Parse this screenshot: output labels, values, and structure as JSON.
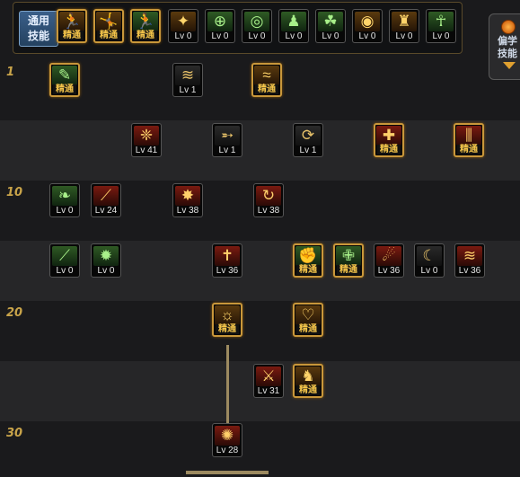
{
  "common_panel": {
    "label": "通用\n技能"
  },
  "right_panel": {
    "label": "偏学\n技能"
  },
  "level_labels": [
    "1",
    "10",
    "20",
    "30"
  ],
  "common_skills": [
    {
      "icon": "running-figure-icon",
      "tint": "gold",
      "text": "精通",
      "mastered": true
    },
    {
      "icon": "leaping-figure-icon",
      "tint": "gold",
      "text": "精通",
      "mastered": true
    },
    {
      "icon": "dash-figure-icon",
      "tint": "green",
      "text": "精通",
      "mastered": true
    },
    {
      "icon": "winged-emblem-icon",
      "tint": "gold",
      "text": "Lv 0",
      "mastered": false
    },
    {
      "icon": "crosshair-icon",
      "tint": "green",
      "text": "Lv 0",
      "mastered": false
    },
    {
      "icon": "target-reticle-icon",
      "tint": "green",
      "text": "Lv 0",
      "mastered": false
    },
    {
      "icon": "figure-pose-icon",
      "tint": "green",
      "text": "Lv 0",
      "mastered": false
    },
    {
      "icon": "figure-swirl-icon",
      "tint": "green",
      "text": "Lv 0",
      "mastered": false
    },
    {
      "icon": "eye-icon",
      "tint": "gold",
      "text": "Lv 0",
      "mastered": false
    },
    {
      "icon": "crowd-icon",
      "tint": "gold",
      "text": "Lv 0",
      "mastered": false
    },
    {
      "icon": "spirit-figure-icon",
      "tint": "green",
      "text": "Lv 0",
      "mastered": false
    }
  ],
  "skills": {
    "r1": [
      {
        "icon": "scroll-icon",
        "tint": "green",
        "text": "精通",
        "mastered": true
      },
      {
        "icon": "claw-slash-icon",
        "tint": "dark",
        "text": "Lv 1",
        "mastered": false
      },
      {
        "icon": "wave-slash-icon",
        "tint": "gold",
        "text": "精通",
        "mastered": true
      }
    ],
    "r2": [
      {
        "icon": "wing-burst-icon",
        "tint": "red",
        "text": "Lv 41",
        "mastered": false
      },
      {
        "icon": "arrow-strike-icon",
        "tint": "dark",
        "text": "Lv 1",
        "mastered": false
      },
      {
        "icon": "whirlwind-icon",
        "tint": "dark",
        "text": "Lv 1",
        "mastered": false
      },
      {
        "icon": "shield-icon",
        "tint": "red",
        "text": "精通",
        "mastered": true
      },
      {
        "icon": "triple-blade-icon",
        "tint": "red",
        "text": "精通",
        "mastered": true
      }
    ],
    "r3": [
      {
        "icon": "leaf-blade-icon",
        "tint": "green",
        "text": "Lv 0",
        "mastered": false
      },
      {
        "icon": "long-blade-icon",
        "tint": "red",
        "text": "Lv 24",
        "mastered": false
      },
      {
        "icon": "explosion-icon",
        "tint": "red",
        "text": "Lv 38",
        "mastered": false
      },
      {
        "icon": "spiral-strike-icon",
        "tint": "red",
        "text": "Lv 38",
        "mastered": false
      }
    ],
    "r4": [
      {
        "icon": "greatsword-icon",
        "tint": "green",
        "text": "Lv 0",
        "mastered": false
      },
      {
        "icon": "green-burst-icon",
        "tint": "green",
        "text": "Lv 0",
        "mastered": false
      },
      {
        "icon": "cross-blade-icon",
        "tint": "red",
        "text": "Lv 36",
        "mastered": false
      },
      {
        "icon": "muscle-figure-icon",
        "tint": "green",
        "text": "精通",
        "mastered": true
      },
      {
        "icon": "holy-cross-icon",
        "tint": "green",
        "text": "精通",
        "mastered": true
      },
      {
        "icon": "fire-arc-icon",
        "tint": "red",
        "text": "Lv 36",
        "mastered": false
      },
      {
        "icon": "crescent-icon",
        "tint": "dark",
        "text": "Lv 0",
        "mastered": false
      },
      {
        "icon": "flame-wave-icon",
        "tint": "red",
        "text": "Lv 36",
        "mastered": false
      }
    ],
    "r5": [
      {
        "icon": "radiant-orb-icon",
        "tint": "gold",
        "text": "精通",
        "mastered": true
      },
      {
        "icon": "heart-guard-icon",
        "tint": "gold",
        "text": "精通",
        "mastered": true
      }
    ],
    "r6": [
      {
        "icon": "fury-slash-icon",
        "tint": "red",
        "text": "Lv 31",
        "mastered": false
      },
      {
        "icon": "rising-figure-icon",
        "tint": "gold",
        "text": "精通",
        "mastered": true
      }
    ],
    "r7": [
      {
        "icon": "starburst-icon",
        "tint": "red",
        "text": "Lv 28",
        "mastered": false
      }
    ]
  },
  "glyphs": {
    "running-figure-icon": "🏃",
    "leaping-figure-icon": "🤸",
    "dash-figure-icon": "🏃",
    "winged-emblem-icon": "✦",
    "crosshair-icon": "⊕",
    "target-reticle-icon": "◎",
    "figure-pose-icon": "♟",
    "figure-swirl-icon": "☘",
    "eye-icon": "◉",
    "crowd-icon": "♜",
    "spirit-figure-icon": "☥",
    "scroll-icon": "✎",
    "claw-slash-icon": "≋",
    "wave-slash-icon": "≈",
    "wing-burst-icon": "❈",
    "arrow-strike-icon": "➵",
    "whirlwind-icon": "⟳",
    "shield-icon": "✚",
    "triple-blade-icon": "⫼",
    "leaf-blade-icon": "❧",
    "long-blade-icon": "⟋",
    "explosion-icon": "✸",
    "spiral-strike-icon": "↻",
    "greatsword-icon": "⟋",
    "green-burst-icon": "✹",
    "cross-blade-icon": "✝",
    "muscle-figure-icon": "✊",
    "holy-cross-icon": "✙",
    "fire-arc-icon": "☄",
    "crescent-icon": "☾",
    "flame-wave-icon": "≋",
    "radiant-orb-icon": "☼",
    "heart-guard-icon": "♡",
    "fury-slash-icon": "⚔",
    "rising-figure-icon": "♞",
    "starburst-icon": "✺"
  }
}
